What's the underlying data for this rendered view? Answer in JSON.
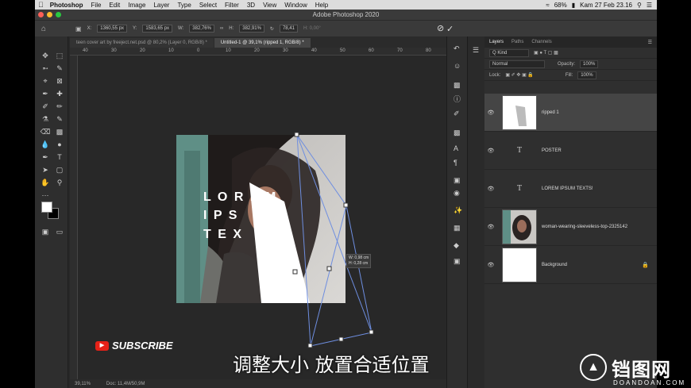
{
  "menubar": {
    "app_name": "Photoshop",
    "menus": [
      "File",
      "Edit",
      "Image",
      "Layer",
      "Type",
      "Select",
      "Filter",
      "3D",
      "View",
      "Window",
      "Help"
    ],
    "battery": "68%",
    "clock": "Kam 27 Feb  23.16"
  },
  "window": {
    "title": "Adobe Photoshop 2020"
  },
  "options": {
    "x_label": "X:",
    "x_value": "1360,55 px",
    "y_label": "Y:",
    "y_value": "1583,65 px",
    "w_label": "W:",
    "w_value": "382,76%",
    "h_label": "H:",
    "h_value": "382,91%",
    "angle_value": "78,41",
    "interp": "H: 0,00°",
    "cancel_icon": "⃠",
    "commit_icon": "✓"
  },
  "tabs": [
    {
      "label": "teen cover art by freeject.net.psd @ 80,2% (Layer 0, RGB/8) *"
    },
    {
      "label": "Untitled-1 @ 39,1% (ripped 1, RGB/8) *"
    }
  ],
  "hruler": [
    "40",
    "30",
    "20",
    "10",
    "0",
    "10",
    "20",
    "30",
    "40",
    "50",
    "60",
    "70",
    "80",
    "90"
  ],
  "document": {
    "headline": "LOREM IPSUM TEXTS!",
    "line1": "L O R E M",
    "line2": "I P S",
    "line3": "T E X",
    "measure_w": "W: 0,98 cm",
    "measure_h": "H: 0,28 cm"
  },
  "status": {
    "zoom": "39,11%",
    "doc": "Doc: 11,4M/50,9M"
  },
  "layers_panel": {
    "tabs": [
      "Layers",
      "Paths",
      "Channels"
    ],
    "kind_label": "Q Kind",
    "blend_mode": "Normal",
    "opacity_label": "Opacity:",
    "opacity_value": "100%",
    "lock_label": "Lock:",
    "fill_label": "Fill:",
    "fill_value": "100%",
    "layers": [
      {
        "name": "ripped 1"
      },
      {
        "name": "POSTER"
      },
      {
        "name": "LOREM IPSUM TEXTS!"
      },
      {
        "name": "woman-wearing-sleeveless-top-2325142"
      },
      {
        "name": "Background"
      }
    ]
  },
  "overlay": {
    "subscribe": "SUBSCRIBE",
    "subtitle": "调整大小 放置合适位置",
    "watermark_title": "铛图网",
    "watermark_url": "DOANDOAN.COM"
  },
  "colors": {
    "accent": "#1473e6",
    "panel": "#2f2f2f",
    "canvas": "#282828"
  }
}
